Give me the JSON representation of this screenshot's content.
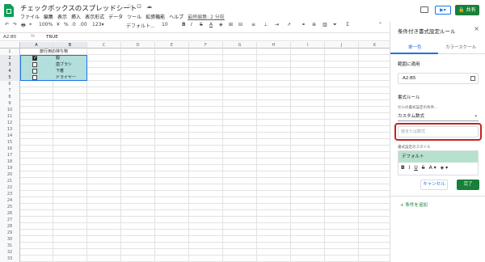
{
  "app": {
    "title": "チェックボックスのスプレッドシート",
    "title_icons": [
      "☆",
      "⊡",
      "☁"
    ],
    "menus": [
      "ファイル",
      "編集",
      "表示",
      "挿入",
      "表示形式",
      "データ",
      "ツール",
      "拡張機能",
      "ヘルプ"
    ],
    "last_edit": "最終編集: 2 分前",
    "present_label": "▶▾",
    "share_label": "🔒 共有"
  },
  "toolbar": {
    "undo": "↶",
    "redo": "↷",
    "print": "🖶",
    "paint": "⌖",
    "zoom": "100%",
    "currency": "¥",
    "percent": "%",
    "dec1": ".0",
    "dec2": ".00",
    "numfmt": "123▾",
    "font": "デフォルト...",
    "fontsize": "10",
    "bold": "B",
    "italic": "I",
    "strike": "S",
    "textcolor": "A",
    "fill": "◈",
    "borders": "⊞",
    "merge": "⊟",
    "halign": "≡",
    "valign": "⊥",
    "wrap": "⇥",
    "rotate": "↗",
    "link": "⚭",
    "comment": "⊕",
    "chart": "▥",
    "filter": "⏷",
    "func": "Σ",
    "more": "⌃"
  },
  "formula": {
    "name_box": "A2:B5",
    "fx": "fx",
    "value": "TRUE"
  },
  "grid": {
    "columns": [
      "A",
      "B",
      "C",
      "D",
      "E",
      "F",
      "G",
      "H",
      "I",
      "J",
      "K"
    ],
    "header_text": "旅行用の持ち物",
    "items": [
      {
        "checked": true,
        "label": "服"
      },
      {
        "checked": false,
        "label": "歯ブラシ"
      },
      {
        "checked": false,
        "label": "下着"
      },
      {
        "checked": false,
        "label": "ドライヤー"
      }
    ],
    "row_count": 33
  },
  "panel": {
    "title": "条件付き書式設定ルール",
    "close": "×",
    "tab_single": "単一色",
    "tab_scale": "カラースケール",
    "range_label": "範囲に適用",
    "range_value": "A2:B5",
    "rules_label": "書式ルール",
    "cond_hint": "セルの書式設定の条件...",
    "condition": "カスタム数式",
    "condition_arrow": "▾",
    "value_placeholder": "値または数式",
    "style_hint": "書式設定のスタイル",
    "style_name": "デフォルト",
    "style_icons": [
      "B",
      "I",
      "U",
      "S",
      "A ▾",
      "◈ ▾"
    ],
    "cancel": "キャンセル",
    "done": "完了",
    "add_rule": "+ 条件を追加"
  },
  "colors": {
    "accent": "#1a73e8",
    "green": "#188038",
    "selection": "#b2dfdb",
    "highlight": "#c5221f"
  }
}
